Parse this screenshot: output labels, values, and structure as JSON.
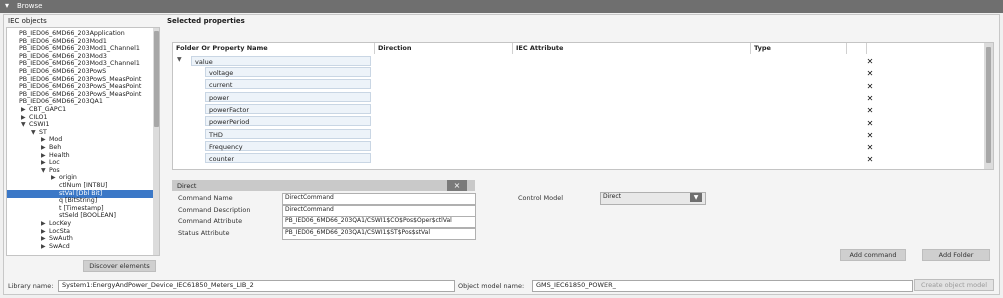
{
  "window": {
    "title": "Browse"
  },
  "left": {
    "header": "IEC objects",
    "tree": [
      {
        "text": "PB_IED06_6MD66_203Application",
        "toggle": ""
      },
      {
        "text": "PB_IED06_6MD66_203Mod1",
        "toggle": ""
      },
      {
        "text": "PB_IED06_6MD66_203Mod1_Channel1",
        "toggle": ""
      },
      {
        "text": "PB_IED06_6MD66_203Mod3",
        "toggle": ""
      },
      {
        "text": "PB_IED06_6MD66_203Mod3_Channel1",
        "toggle": ""
      },
      {
        "text": "PB_IED06_6MD66_203PowS",
        "toggle": ""
      },
      {
        "text": "PB_IED06_6MD66_203PowS_MeasPoint",
        "toggle": ""
      },
      {
        "text": "PB_IED06_6MD66_203PowS_MeasPoint",
        "toggle": ""
      },
      {
        "text": "PB_IED06_6MD66_203PowS_MeasPoint",
        "toggle": ""
      },
      {
        "text": "PB_IED06_6MD66_203QA1",
        "toggle": ""
      },
      {
        "text": "CBT_GAPC1",
        "toggle": "▶"
      },
      {
        "text": "CILO1",
        "toggle": "▶"
      },
      {
        "text": "CSWI1",
        "toggle": "▼"
      },
      {
        "text": "ST",
        "toggle": "▼"
      },
      {
        "text": "Mod",
        "toggle": "▶"
      },
      {
        "text": "Beh",
        "toggle": "▶"
      },
      {
        "text": "Health",
        "toggle": "▶"
      },
      {
        "text": "Loc",
        "toggle": "▶"
      },
      {
        "text": "Pos",
        "toggle": "▼"
      },
      {
        "text": "origin",
        "toggle": "▶"
      },
      {
        "text": "ctlNum [INT8U]",
        "toggle": ""
      },
      {
        "text": "stVal [Dbl Bit]",
        "toggle": ""
      },
      {
        "text": "q [BitString]",
        "toggle": ""
      },
      {
        "text": "t [Timestamp]",
        "toggle": ""
      },
      {
        "text": "stSeld [BOOLEAN]",
        "toggle": ""
      },
      {
        "text": "LocKey",
        "toggle": "▶"
      },
      {
        "text": "LocSta",
        "toggle": "▶"
      },
      {
        "text": "SwAuth",
        "toggle": "▶"
      },
      {
        "text": "SwAcd",
        "toggle": "▶"
      }
    ],
    "discover_label": "Discover elements"
  },
  "right": {
    "header": "Selected properties",
    "columns": [
      "Folder Or Property Name",
      "Direction",
      "IEC Attribute",
      "Type"
    ],
    "root": "value",
    "properties": [
      "voltage",
      "current",
      "power",
      "powerFactor",
      "powerPeriod",
      "THD",
      "Frequency",
      "counter"
    ],
    "detail": {
      "title": "Direct",
      "close": "×",
      "rows": [
        {
          "label": "Command Name",
          "value": "DirectCommand"
        },
        {
          "label": "Command Description",
          "value": "DirectCommand"
        },
        {
          "label": "Command Attribute",
          "value": "PB_IED06_6MD66_203QA1/CSWI1$CO$Pos$Oper$ctlVal"
        },
        {
          "label": "Status Attribute",
          "value": "PB_IED06_6MD66_203QA1/CSWI1$ST$Pos$stVal"
        }
      ],
      "control_model_label": "Control Model",
      "control_model_value": "Direct"
    },
    "add_command_label": "Add command",
    "add_folder_label": "Add Folder"
  },
  "footer": {
    "library_label": "Library name:",
    "library_value": "System1:EnergyAndPower_Device_IEC61850_Meters_LIB_2",
    "object_model_label": "Object model name:",
    "object_model_value": "GMS_IEC61850_POWER_",
    "create_label": "Create object model"
  }
}
